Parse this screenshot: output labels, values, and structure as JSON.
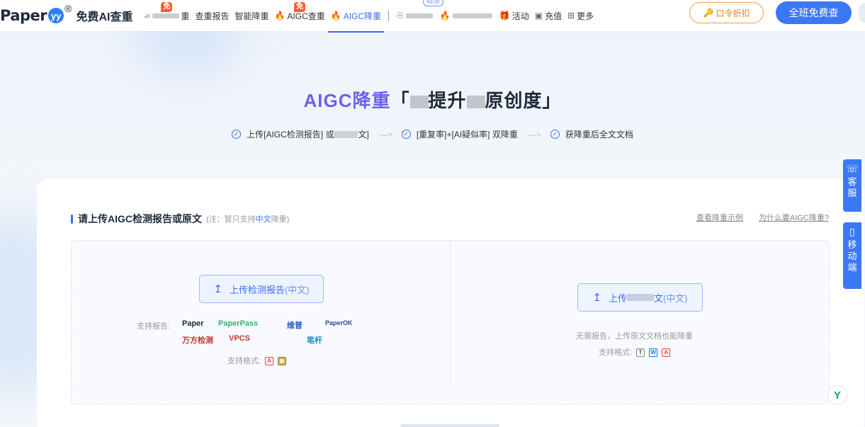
{
  "nav": {
    "logo": "Paper",
    "logo_badge": "yy",
    "logo_reg": "®",
    "logo_sub": "免费AI查重",
    "items": [
      {
        "label": "重",
        "badge": "免"
      },
      {
        "label": "查重报告"
      },
      {
        "label": "智能降重"
      },
      {
        "label": "AIGC查重",
        "badge": "免"
      },
      {
        "label": "AIGC降重"
      },
      {
        "label": "",
        "badge": "NEW"
      },
      {
        "label": "活动"
      },
      {
        "label": "充值"
      },
      {
        "label": "更多"
      }
    ],
    "coupon_btn": "口令折扣",
    "free_btn": "全班免费查"
  },
  "hero": {
    "title_accent": "AIGC降重",
    "title_part1": "「",
    "title_part2": "提升",
    "title_part3": "原创度」",
    "steps": [
      {
        "pre": "上传[AIGC检测报告] 或",
        "post": "文]"
      },
      {
        "pre": "[重复率]+[AI疑似率] 双降重",
        "post": ""
      },
      {
        "pre": "获降重后全文文档",
        "post": ""
      }
    ],
    "arrow": "---->"
  },
  "section": {
    "title": "请上传AIGC检测报告或原文",
    "note_prefix": "(注：暂只支持",
    "note_highlight": "中文",
    "note_suffix": "降重)",
    "link_example": "查看降重示例",
    "link_why": "为什么要AIGC降重?"
  },
  "left": {
    "button_main": "上传检测报告",
    "button_suffix": "(中文)",
    "support_report_label": "支持报告:",
    "brands": [
      "Paper",
      "PaperPass",
      "维普",
      "PaperOK",
      "万方检测",
      "VPCS",
      "笔杆"
    ],
    "support_format_label": "支持格式:"
  },
  "right": {
    "button_main": "上传",
    "button_mid": "文",
    "button_suffix": "(中文)",
    "no_report": "无需报告，上传原文文档也能降重",
    "support_format_label": "支持格式:",
    "formats": [
      "T",
      "W",
      "PDF"
    ]
  },
  "side": {
    "service": [
      "客",
      "服"
    ],
    "mobile": [
      "移",
      "动",
      "端"
    ]
  },
  "colors": {
    "accent": "#3b78f6",
    "title_accent": "#6a62f0",
    "coupon": "#ff7a1a",
    "hot": "#f0452e"
  }
}
